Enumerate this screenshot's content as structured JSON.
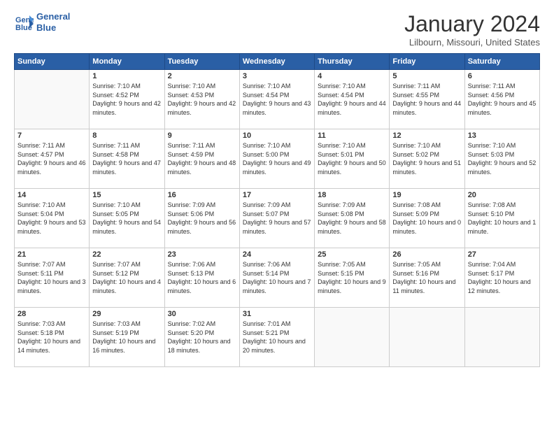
{
  "header": {
    "logo_line1": "General",
    "logo_line2": "Blue",
    "month": "January 2024",
    "location": "Lilbourn, Missouri, United States"
  },
  "days_of_week": [
    "Sunday",
    "Monday",
    "Tuesday",
    "Wednesday",
    "Thursday",
    "Friday",
    "Saturday"
  ],
  "weeks": [
    [
      {
        "day": "",
        "sunrise": "",
        "sunset": "",
        "daylight": ""
      },
      {
        "day": "1",
        "sunrise": "7:10 AM",
        "sunset": "4:52 PM",
        "daylight": "9 hours and 42 minutes."
      },
      {
        "day": "2",
        "sunrise": "7:10 AM",
        "sunset": "4:53 PM",
        "daylight": "9 hours and 42 minutes."
      },
      {
        "day": "3",
        "sunrise": "7:10 AM",
        "sunset": "4:54 PM",
        "daylight": "9 hours and 43 minutes."
      },
      {
        "day": "4",
        "sunrise": "7:10 AM",
        "sunset": "4:54 PM",
        "daylight": "9 hours and 44 minutes."
      },
      {
        "day": "5",
        "sunrise": "7:11 AM",
        "sunset": "4:55 PM",
        "daylight": "9 hours and 44 minutes."
      },
      {
        "day": "6",
        "sunrise": "7:11 AM",
        "sunset": "4:56 PM",
        "daylight": "9 hours and 45 minutes."
      }
    ],
    [
      {
        "day": "7",
        "sunrise": "7:11 AM",
        "sunset": "4:57 PM",
        "daylight": "9 hours and 46 minutes."
      },
      {
        "day": "8",
        "sunrise": "7:11 AM",
        "sunset": "4:58 PM",
        "daylight": "9 hours and 47 minutes."
      },
      {
        "day": "9",
        "sunrise": "7:11 AM",
        "sunset": "4:59 PM",
        "daylight": "9 hours and 48 minutes."
      },
      {
        "day": "10",
        "sunrise": "7:10 AM",
        "sunset": "5:00 PM",
        "daylight": "9 hours and 49 minutes."
      },
      {
        "day": "11",
        "sunrise": "7:10 AM",
        "sunset": "5:01 PM",
        "daylight": "9 hours and 50 minutes."
      },
      {
        "day": "12",
        "sunrise": "7:10 AM",
        "sunset": "5:02 PM",
        "daylight": "9 hours and 51 minutes."
      },
      {
        "day": "13",
        "sunrise": "7:10 AM",
        "sunset": "5:03 PM",
        "daylight": "9 hours and 52 minutes."
      }
    ],
    [
      {
        "day": "14",
        "sunrise": "7:10 AM",
        "sunset": "5:04 PM",
        "daylight": "9 hours and 53 minutes."
      },
      {
        "day": "15",
        "sunrise": "7:10 AM",
        "sunset": "5:05 PM",
        "daylight": "9 hours and 54 minutes."
      },
      {
        "day": "16",
        "sunrise": "7:09 AM",
        "sunset": "5:06 PM",
        "daylight": "9 hours and 56 minutes."
      },
      {
        "day": "17",
        "sunrise": "7:09 AM",
        "sunset": "5:07 PM",
        "daylight": "9 hours and 57 minutes."
      },
      {
        "day": "18",
        "sunrise": "7:09 AM",
        "sunset": "5:08 PM",
        "daylight": "9 hours and 58 minutes."
      },
      {
        "day": "19",
        "sunrise": "7:08 AM",
        "sunset": "5:09 PM",
        "daylight": "10 hours and 0 minutes."
      },
      {
        "day": "20",
        "sunrise": "7:08 AM",
        "sunset": "5:10 PM",
        "daylight": "10 hours and 1 minute."
      }
    ],
    [
      {
        "day": "21",
        "sunrise": "7:07 AM",
        "sunset": "5:11 PM",
        "daylight": "10 hours and 3 minutes."
      },
      {
        "day": "22",
        "sunrise": "7:07 AM",
        "sunset": "5:12 PM",
        "daylight": "10 hours and 4 minutes."
      },
      {
        "day": "23",
        "sunrise": "7:06 AM",
        "sunset": "5:13 PM",
        "daylight": "10 hours and 6 minutes."
      },
      {
        "day": "24",
        "sunrise": "7:06 AM",
        "sunset": "5:14 PM",
        "daylight": "10 hours and 7 minutes."
      },
      {
        "day": "25",
        "sunrise": "7:05 AM",
        "sunset": "5:15 PM",
        "daylight": "10 hours and 9 minutes."
      },
      {
        "day": "26",
        "sunrise": "7:05 AM",
        "sunset": "5:16 PM",
        "daylight": "10 hours and 11 minutes."
      },
      {
        "day": "27",
        "sunrise": "7:04 AM",
        "sunset": "5:17 PM",
        "daylight": "10 hours and 12 minutes."
      }
    ],
    [
      {
        "day": "28",
        "sunrise": "7:03 AM",
        "sunset": "5:18 PM",
        "daylight": "10 hours and 14 minutes."
      },
      {
        "day": "29",
        "sunrise": "7:03 AM",
        "sunset": "5:19 PM",
        "daylight": "10 hours and 16 minutes."
      },
      {
        "day": "30",
        "sunrise": "7:02 AM",
        "sunset": "5:20 PM",
        "daylight": "10 hours and 18 minutes."
      },
      {
        "day": "31",
        "sunrise": "7:01 AM",
        "sunset": "5:21 PM",
        "daylight": "10 hours and 20 minutes."
      },
      {
        "day": "",
        "sunrise": "",
        "sunset": "",
        "daylight": ""
      },
      {
        "day": "",
        "sunrise": "",
        "sunset": "",
        "daylight": ""
      },
      {
        "day": "",
        "sunrise": "",
        "sunset": "",
        "daylight": ""
      }
    ]
  ],
  "labels": {
    "sunrise": "Sunrise:",
    "sunset": "Sunset:",
    "daylight": "Daylight:"
  }
}
